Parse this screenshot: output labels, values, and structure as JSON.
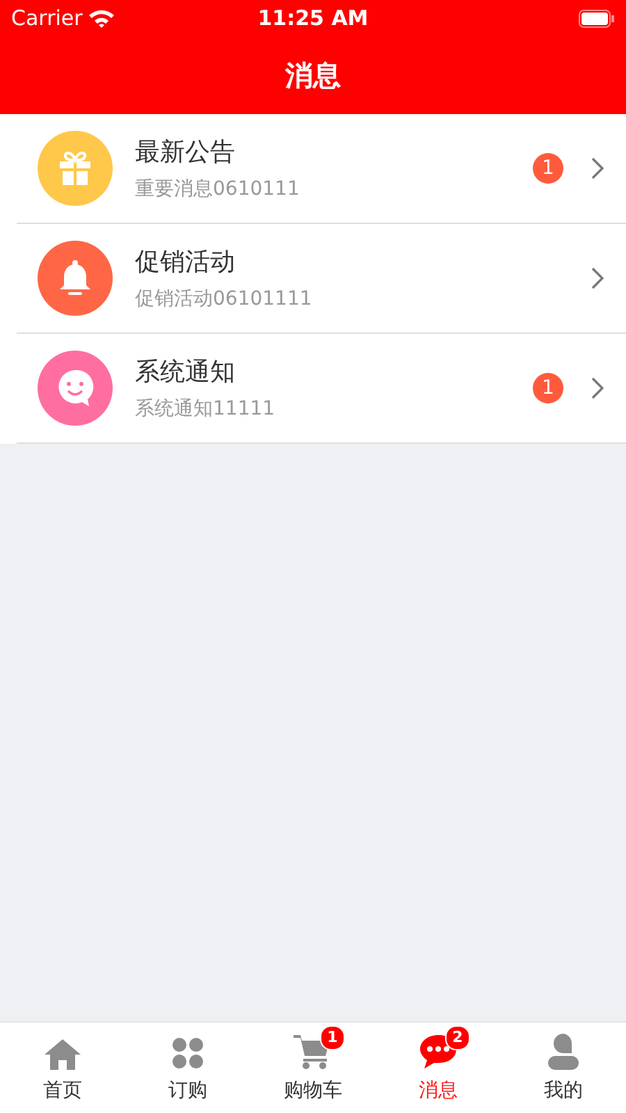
{
  "status_bar": {
    "carrier": "Carrier",
    "time": "11:25 AM"
  },
  "nav": {
    "title": "消息"
  },
  "messages": [
    {
      "kind": "gift",
      "color": "#ffc84a",
      "title": "最新公告",
      "subtitle": "重要消息0610111",
      "badge": "1"
    },
    {
      "kind": "bell",
      "color": "#ff6646",
      "title": "促销活动",
      "subtitle": "促销活动06101111"
    },
    {
      "kind": "smile",
      "color": "#ff6ea0",
      "title": "系统通知",
      "subtitle": "系统通知11111",
      "badge": "1"
    }
  ],
  "tabs": [
    {
      "kind": "home",
      "label": "首页",
      "selected": false
    },
    {
      "kind": "grid",
      "label": "订购",
      "selected": false
    },
    {
      "kind": "cart",
      "label": "购物车",
      "selected": false,
      "badge": "1"
    },
    {
      "kind": "chat",
      "label": "消息",
      "selected": true,
      "badge": "2"
    },
    {
      "kind": "person",
      "label": "我的",
      "selected": false
    }
  ]
}
